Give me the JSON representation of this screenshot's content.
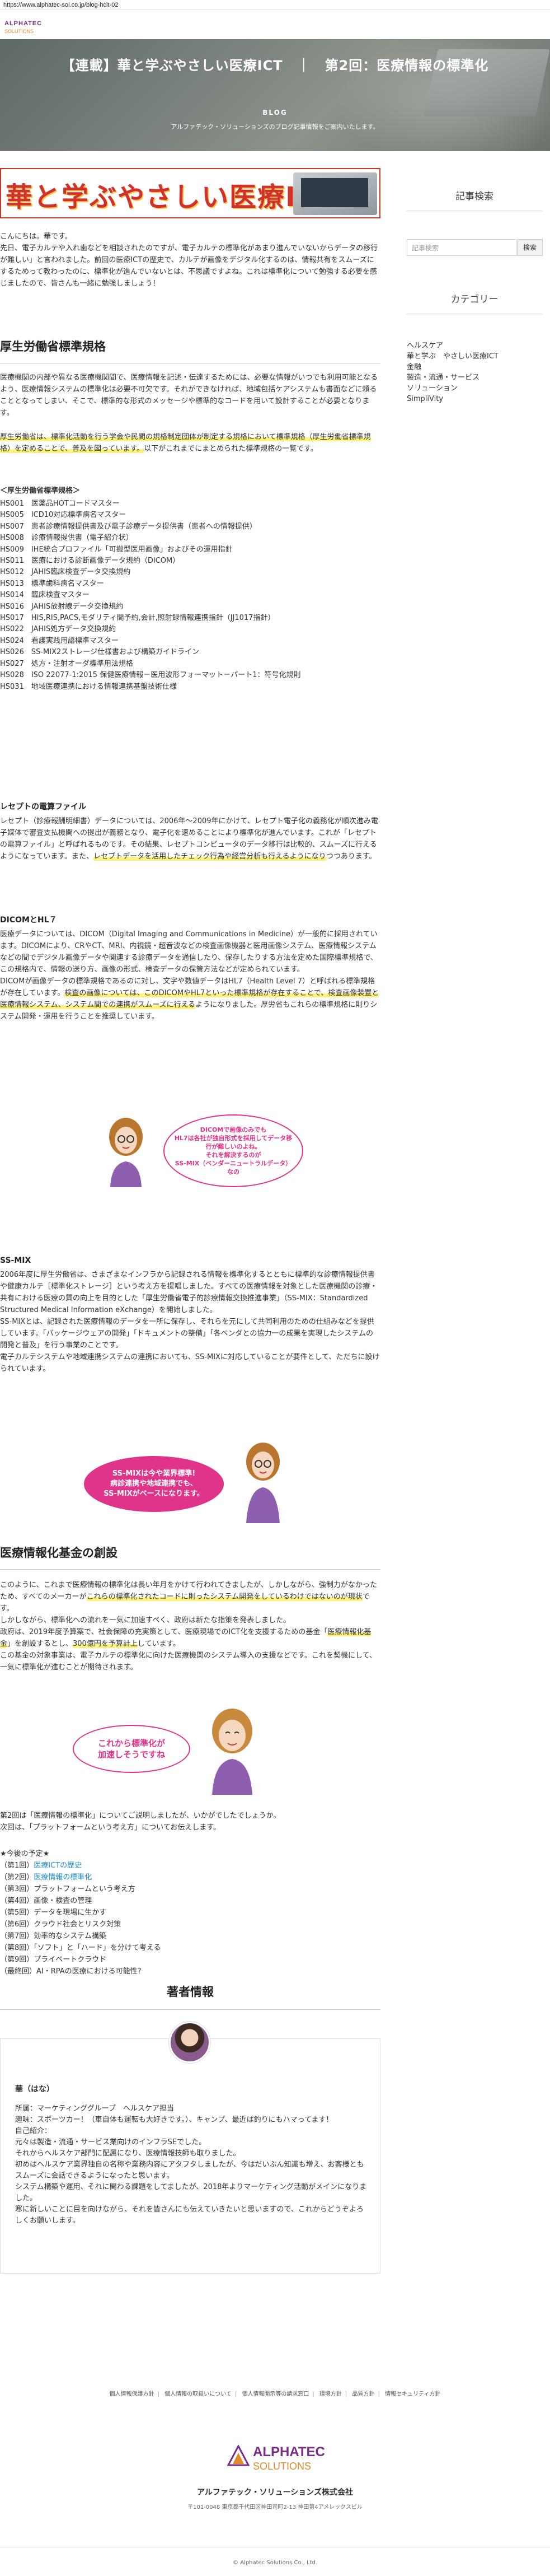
{
  "browser": {
    "url": "https://www.alphatec-sol.co.jp/blog-hcit-02"
  },
  "logo": {
    "line1": "ALPHATEC",
    "line2": "SOLUTIONS"
  },
  "hero": {
    "title": "【連載】華と学ぶやさしい医療ICT　｜　第2回：医療情報の標準化",
    "label": "BLOG",
    "subtitle": "アルファテック・ソリューションズのブログ記事情報をご案内いたします。"
  },
  "banner": {
    "text": "華と学ぶやさしい医療ICT"
  },
  "sidebar": {
    "search_title": "記事検索",
    "search_placeholder": "記事検索",
    "search_button": "検索",
    "category_title": "カテゴリー",
    "categories": [
      "ヘルスケア",
      "華と学ぶ　やさしい医療ICT",
      "金融",
      "製造・流通・サービス",
      "ソリューション",
      "SimpliVity"
    ]
  },
  "article": {
    "intro": "こんにちは。華です。\n先日、電子カルテや入れ歯などを相談されたのですが、電子カルテの標準化があまり進んでいないからデータの移行が難しい」と言われました。前回の医療ICTの歴史で、カルテが画像をデジタル化するのは、情報共有をスムーズにするためって教わったのに、標準化が進んでいないとは、不思議ですよね。これは標準化について勉強する必要を感じましたので、皆さんも一緒に勉強しましょう！",
    "s1_title": "厚生労働省標準規格",
    "s1_p1": "医療機関の内部や異なる医療機関間で、医療情報を記述・伝達するためには、必要な情報がいつでも利用可能となるよう、医療情報システムの標準化は必要不可欠です。それができなければ、地域包括ケアシステムも書面などに頼ることとなってしまい、そこで、標準的な形式のメッセージや標準的なコードを用いて設計することが必要となります。",
    "s1_p2_hl": "厚生労働省は、標準化活動を行う学会や民間の規格制定団体が制定する規格において標準規格（厚生労働省標準規格）を定めることで、普及を図っています。",
    "s1_p2_rest": "以下がこれまでにまとめられた標準規格の一覧です。",
    "list_title": "＜厚生労働省標準規格＞",
    "standards": [
      "HS001　医薬品HOTコードマスター",
      "HS005　ICD10対応標準病名マスター",
      "HS007　患者診療情報提供書及び電子診療データ提供書（患者への情報提供）",
      "HS008　診療情報提供書（電子紹介状）",
      "HS009　IHE統合プロファイル「可搬型医用画像」およびその運用指針",
      "HS011　医療における診断画像データ規約（DICOM）",
      "HS012　JAHIS臨床検査データ交換規約",
      "HS013　標準歯科病名マスター",
      "HS014　臨床検査マスター",
      "HS016　JAHIS放射線データ交換規約",
      "HS017　HIS,RIS,PACS,モダリティ間予約,会計,照射録情報連携指針（JJ1017指針）",
      "HS022　JAHIS処方データ交換規約",
      "HS024　看護実践用語標準マスター",
      "HS026　SS-MIX2ストレージ仕様書および構築ガイドライン",
      "HS027　処方・注射オーダ標準用法規格",
      "HS028　ISO 22077-1:2015 保健医療情報－医用波形フォーマット－パート1：符号化規則",
      "HS031　地域医療連携における情報連携基盤技術仕様"
    ],
    "s2_title": "レセプトの電算ファイル",
    "s2_p_a": "レセプト（診療報酬明細書）データについては、2006年〜2009年にかけて、レセプト電子化の義務化が順次進み電子媒体で審査支払機関への提出が義務となり、電子化を速めることにより標準化が進んでいます。これが「レセプトの電算ファイル」と呼ばれるものです。その結果、レセプトコンピュータのデータ移行は比較的、スムーズに行えるようになっています。また、",
    "s2_p_hl": "レセプトデータを活用したチェック行為や経営分析も行えるようになり",
    "s2_p_b": "つつあります。",
    "s3_title": "DICOMとHL７",
    "s3_p_a": "医療データについては、DICOM（Digital Imaging and Communications in Medicine）が一般的に採用されています。DICOMにより、CRやCT、MRI、内視鏡・超音波などの検査画像機器と医用画像システム、医療情報システムなどの間でデジタル画像データや関連する診療データを通信したり、保存したりする方法を定めた国際標準規格で、この規格内で、情報の送り方、画像の形式、検査データの保管方法などが定められています。\nDICOMが画像データの標準規格であるのに対し、文字や数値データはHL7（Health Level 7）と呼ばれる標準規格が存在しています。",
    "s3_p_hl1": "検査の画像については、このDICOMやHL7といった標準規格が存在することで、",
    "s3_p_hl2": "検査画像装置と医療情報システム、システム間での連携がスムーズに行える",
    "s3_p_b": "ようになりました。",
    "s3_p_c": "厚労省もこれらの標準規格に則りシステム開発・運用を行うことを推奨しています。",
    "bubble1": "DICOMで画像のみでも\nHL7は各社が独自形式を採用してデータ移行が難しいのよね。\nそれを解決するのが\nSS-MIX（ベンダーニュートラルデータ）なの",
    "s4_title": "SS-MIX",
    "s4_p": "2006年度に厚生労働省は、さまざまなインフラから記録される情報を標準化するとともに標準的な診療情報提供書や健康カルテ［標準化ストレージ］という考え方を提唱しました。すべての医療情報を対象とした医療機関の診療・共有における医療の質の向上を目的とした「厚生労働省電子的診療情報交換推進事業」（SS-MIX：Standardized Structured Medical Information eXchange）を開始しました。\nSS-MIXとは、記録された医療情報のデータを一所に保存し、それらを元にして共同利用のための仕組みなどを提供しています。「パッケージウェアの開発」「ドキュメントの整備」「各ベンダとの協力一の成果を実現したシステムの開発と普及」を行う事業のことです。\n電子カルテシステムや地域連携システムの連携においても、SS-MIXに対応していることが要件として、ただちに設けられています。",
    "bubble2": "SS-MIXは今や業界標準!\n病診連携や地域連携でも、\nSS-MIXがベースになります。",
    "s5_title": "医療情報化基金の創設",
    "s5_p_a": "このように、これまで医療情報の標準化は長い年月をかけて行われてきましたが、しかしながら、強制力がなかったため、すべてのメーカーが",
    "s5_p_hl1": "これらの標準化されたコードに則ったシステム開発をしているわけではないのが現状",
    "s5_p_b": "です。\nしかしながら、標準化への流れを一気に加速すべく、政府は新たな指策を発表しました。\n政府は、2019年度予算案で、社会保障の充実策として、医療現場でのICT化を支援するための基金「",
    "s5_p_hl2": "医療情報化基金",
    "s5_p_c": "」を創設するとし、",
    "s5_p_hl3": "300億円を予算計上",
    "s5_p_d": "しています。\nこの基金の対象事業は、電子カルテの標準化に向けた医療機関のシステム導入の支援などです。これを契機にして、一気に標準化が進むことが期待されます。",
    "bubble3": "これから標準化が\n加速しそうですね",
    "closing": "第2回は「医療情報の標準化」についてご説明しましたが、いかがでしたでしょうか。\n次回は、「プラットフォームという考え方」についてお伝えします。",
    "toc_title": "★今後の予定★",
    "toc": [
      {
        "prefix": "（第1回）",
        "label": "医療ICTの歴史",
        "link": true
      },
      {
        "prefix": "（第2回）",
        "label": "医療情報の標準化",
        "link": true
      },
      {
        "prefix": "（第3回）",
        "label": "プラットフォームという考え方",
        "link": false
      },
      {
        "prefix": "（第4回）",
        "label": "画像・検査の管理",
        "link": false
      },
      {
        "prefix": "（第5回）",
        "label": "データを現場に生かす",
        "link": false
      },
      {
        "prefix": "（第6回）",
        "label": "クラウド社会とリスク対策",
        "link": false
      },
      {
        "prefix": "（第7回）",
        "label": "効率的なシステム構築",
        "link": false
      },
      {
        "prefix": "（第8回）",
        "label": "「ソフト」と「ハード」を分けて考える",
        "link": false
      },
      {
        "prefix": "（第9回）",
        "label": "プライベートクラウド",
        "link": false
      },
      {
        "prefix": "（最終回）",
        "label": "AI・RPAの医療における可能性?",
        "link": false
      }
    ]
  },
  "author": {
    "section_title": "著者情報",
    "name": "華（はな）",
    "bio": "所属：マーケティンググループ　ヘルスケア担当\n趣味：スポーツカー！（車自体も運転も大好きです。）、キャンプ、最近は釣りにもハマってます！\n自己紹介：\n元々は製造・流通・サービス業向けのインフラSEでした。\nそれからヘルスケア部門に配属になり、医療情報技師も取りました。\n初めはヘルスケア業界独自の名称や業務内容にアタフタしましたが、今はだいぶん知識も増え、お客様ともスムーズに会話できるようになったと思います。\nシステム構築や運用、それに関わる課題をしてましたが、2018年よりマーケティング活動がメインになりました。\n寒に新しいことに目を向けながら、それを皆さんにも伝えていきたいと思いますので、これからどうぞよろしくお願いします。"
  },
  "footer": {
    "links": [
      "個人情報保護方針",
      "個人情報の取扱いについて",
      "個人情報開示等の請求窓口",
      "環境方針",
      "品質方針",
      "情報セキュリティ方針"
    ],
    "logo_line1": "ALPHATEC",
    "logo_line2": "SOLUTIONS",
    "company": "アルファテック・ソリューションズ株式会社",
    "address": "〒101-0048 東京都千代田区神田司町2-13 神田第4アメレックスビル",
    "copyright": "© Alphatec Solutions Co., Ltd."
  }
}
